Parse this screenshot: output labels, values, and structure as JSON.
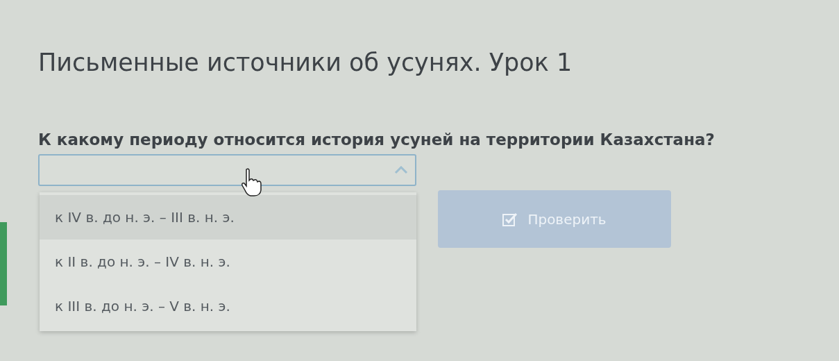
{
  "lesson_title": "Письменные источники об усунях. Урок 1",
  "question": "К какому периоду относится история усуней на территории Казахстана?",
  "dropdown": {
    "expanded": true,
    "options": [
      {
        "label": "к IV в. до н. э. – III в. н. э.",
        "highlighted": true
      },
      {
        "label": "к II в. до н. э. – IV в. н. э.",
        "highlighted": false
      },
      {
        "label": "к III в. до н. э. – V в. н. э.",
        "highlighted": false
      }
    ]
  },
  "check_button": {
    "label": "Проверить",
    "disabled": true
  }
}
